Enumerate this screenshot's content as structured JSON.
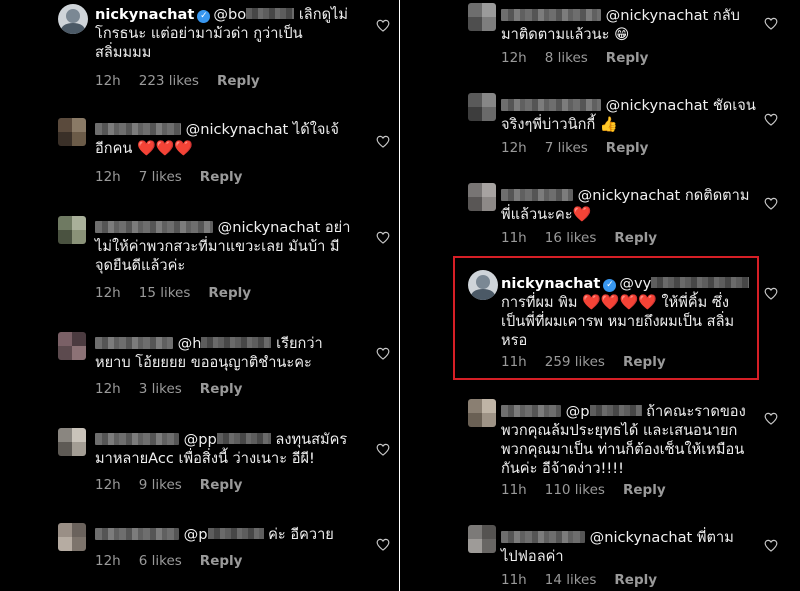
{
  "left": {
    "comments": [
      {
        "user": "nickynachat",
        "verified": true,
        "mention_prefix": "@bo",
        "text_lines": [
          "เลิกดูไม่",
          "โกรธนะ แต่อย่ามาม้วด่า กูว่าเป็น",
          "สลิ่มมมม"
        ],
        "time": "12h",
        "likes": "223 likes",
        "reply": "Reply"
      },
      {
        "user": "",
        "mention": "@nickynachat",
        "text_lines": [
          "ได้ใจเจ้",
          "อีกคน"
        ],
        "hearts": "❤️❤️❤️",
        "time": "12h",
        "likes": "7 likes",
        "reply": "Reply"
      },
      {
        "user": "",
        "mention": "@nickynachat",
        "text_lines": [
          "อย่า",
          "ไม่ให้ค่าพวกสวะที่มาแขวะเลย มันบ้า มี",
          "จุดยืนดีแล้วค่ะ"
        ],
        "time": "12h",
        "likes": "15 likes",
        "reply": "Reply"
      },
      {
        "user": "",
        "mention_prefix": "@h",
        "text_lines": [
          "เรียกว่า",
          "หยาบ โอ้ยยยย ขออนุญาติชำนะคะ"
        ],
        "time": "12h",
        "likes": "3 likes",
        "reply": "Reply"
      },
      {
        "user": "",
        "mention_prefix": "@pp",
        "text_lines": [
          "ลงทุนสมัคร",
          "มาหลายAcc เพื่อสิ่งนี้ ว่างเนาะ อีผี!"
        ],
        "time": "12h",
        "likes": "9 likes",
        "reply": "Reply"
      },
      {
        "user": "",
        "mention_prefix": "@p",
        "text_lines": [
          "ค่ะ อีควาย"
        ],
        "time": "12h",
        "likes": "6 likes",
        "reply": "Reply"
      }
    ]
  },
  "right": {
    "comments": [
      {
        "user": "",
        "mention": "@nickynachat",
        "text_lines": [
          "กลับ",
          "มาติดตามแล้วนะ"
        ],
        "emoji": "😁",
        "time": "12h",
        "likes": "8 likes",
        "reply": "Reply"
      },
      {
        "user": "",
        "mention": "@nickynachat",
        "text_lines": [
          "ชัดเจน",
          "จริงๆพี่บ่าวนิกกี้"
        ],
        "emoji": "👍",
        "time": "12h",
        "likes": "7 likes",
        "reply": "Reply"
      },
      {
        "user": "",
        "mention": "@nickynachat",
        "text_lines": [
          "กดติดตาม",
          "พี่แล้วนะคะ"
        ],
        "hearts": "❤️",
        "time": "11h",
        "likes": "16 likes",
        "reply": "Reply"
      },
      {
        "user": "nickynachat",
        "verified": true,
        "mention_prefix": "@vy",
        "text_lines": [
          "การที่ผม พิม",
          "ให้พี่คิ้ม ซึ่ง",
          "เป็นพี่ที่ผมเคารพ หมายถึงผมเป็น สลิ่ม",
          "หรอ"
        ],
        "hearts": "❤️❤️❤️❤️",
        "time": "11h",
        "likes": "259 likes",
        "reply": "Reply"
      },
      {
        "user": "",
        "mention_prefix": "@p",
        "text_lines": [
          "ถ้าคณะราดของ",
          "พวกคุณล้มประยุทธได้ และเสนอนายก",
          "พวกคุณมาเป็น ท่านก็ต้องเซ็นให้เหมือน",
          "กันค่ะ อีจ้าดง่าว!!!!"
        ],
        "time": "11h",
        "likes": "110 likes",
        "reply": "Reply"
      },
      {
        "user": "",
        "mention": "@nickynachat",
        "text_lines": [
          "พี่ตาม",
          "ไปฟอลค่า"
        ],
        "time": "11h",
        "likes": "14 likes",
        "reply": "Reply"
      }
    ]
  },
  "colors": {
    "background": "#000000",
    "text": "#f0f0f0",
    "meta": "#9a9a9a",
    "verified": "#3897f0",
    "heart": "#ed2a3a",
    "highlight": "#d61f26"
  },
  "icons": {
    "like": "heart-outline-icon",
    "verified": "verified-badge-icon"
  }
}
